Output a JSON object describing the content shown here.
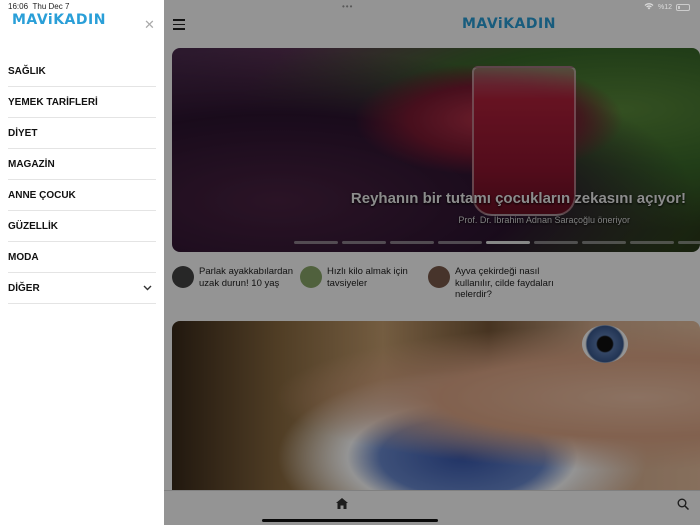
{
  "status": {
    "time": "16:06",
    "date": "Thu Dec 7",
    "battery": "%12"
  },
  "brand": {
    "logo": "MAViKADIN",
    "color": "#2a9fd8"
  },
  "drawer": {
    "items": [
      {
        "label": "SAĞLIK"
      },
      {
        "label": "YEMEK TARİFLERİ"
      },
      {
        "label": "DİYET"
      },
      {
        "label": "MAGAZİN"
      },
      {
        "label": "ANNE ÇOCUK"
      },
      {
        "label": "GÜZELLİK"
      },
      {
        "label": "MODA"
      },
      {
        "label": "DİĞER",
        "expandable": true
      }
    ],
    "close_icon": "close-icon"
  },
  "hero": {
    "title": "Reyhanın bir tutamı çocukların zekasını açıyor!",
    "subtitle": "Prof. Dr. İbrahim Adnan Saraçoğlu öneriyor",
    "slide_count": 9,
    "active_slide": 5
  },
  "ticker": [
    {
      "text": "Parlak ayakkabılardan uzak durun! 10 yaş"
    },
    {
      "text": "Hızlı kilo almak için tavsiyeler"
    },
    {
      "text": "Ayva çekirdeği nasıl kullanılır, cilde faydaları nelerdir?"
    }
  ],
  "bottom_nav": {
    "home": "home-icon",
    "search": "search-icon"
  }
}
